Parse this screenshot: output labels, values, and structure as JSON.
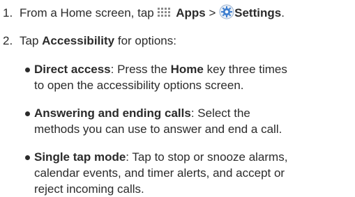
{
  "step1": {
    "number": "1.",
    "text_before": "From a Home screen, tap",
    "apps_label": "Apps",
    "separator": ">",
    "settings_label": "Settings",
    "end_punct": "."
  },
  "step2": {
    "number": "2.",
    "text_before": "Tap",
    "accessibility_label": "Accessibility",
    "text_after": "for options:"
  },
  "bullets": [
    {
      "title": "Direct access",
      "line1_rest": ": Press the",
      "key_label": "Home",
      "line1_tail": "key three times",
      "line2": "to open the accessibility options screen."
    },
    {
      "title": "Answering and ending calls",
      "line1_rest": ": Select the",
      "line2": "methods you can use to answer and end a call."
    },
    {
      "title": "Single tap mode",
      "line1_rest": ": Tap to stop or snooze alarms,",
      "line2": "calendar events, and timer alerts, and accept or",
      "line3": "reject incoming calls."
    }
  ],
  "icons": {
    "apps": "apps-grid-icon",
    "settings": "settings-gear-icon"
  },
  "colors": {
    "text": "#2b2b2b",
    "settings_icon": "#3f7fcf"
  }
}
